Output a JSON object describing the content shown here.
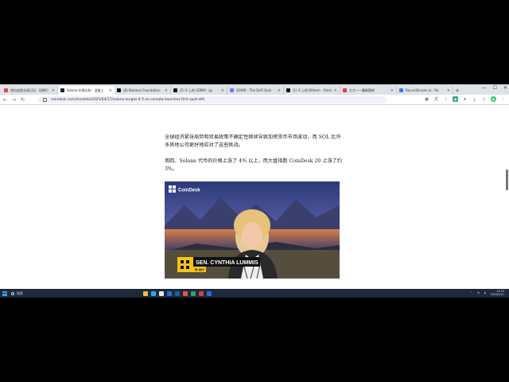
{
  "browser": {
    "tabs": [
      {
        "label": "钱包追踪交易日记：短期行",
        "favicon_color": "#e24a4a"
      },
      {
        "label": "Solana 价格分析：温度上",
        "favicon_color": "#222222",
        "active": true
      },
      {
        "label": "(8) Balance Foundation",
        "favicon_color": "#111111"
      },
      {
        "label": "(1) X 上的 SONIX（@",
        "favicon_color": "#111111"
      },
      {
        "label": "SONIX - The DeFi Quiz",
        "favicon_color": "#6b7cff"
      },
      {
        "label": "(1) X 上的 Bitmon - Omni",
        "favicon_color": "#111111"
      },
      {
        "label": "大力——最新图库",
        "favicon_color": "#e04040"
      },
      {
        "label": "RecordScreen.io - Re",
        "favicon_color": "#2f7df6"
      }
    ],
    "new_tab_label": "+",
    "window_controls": [
      "—",
      "☐",
      "✕"
    ],
    "url": "coindesk.com/markets/2025/04/17/solana-surges-4-5-as-canada-launches-first-spot-etfs"
  },
  "article": {
    "paragraph1": "全球经济紧张局势和贸易政策不确定性继续导致加密货币市场波动，而 SOL 比许多其他公司更好地应对了这些挑战。",
    "paragraph2": "周四，Solana 代币的价格上涨了 4% 以上，而大盘指数 CoinDesk 20 上涨了约 3%。",
    "video": {
      "brand": "CoinDesk",
      "lower_third_name": "SEN. CYNTHIA LUMMIS",
      "lower_third_sub": "R-WY"
    }
  },
  "taskbar": {
    "search_placeholder": "搜索",
    "time": "14:23",
    "date": "2025/4/21",
    "app_colors": [
      "#f0c040",
      "#3aa0f0",
      "#e8e8e8",
      "#1e6fd6",
      "#1b5e9e",
      "#e25a3a",
      "#3c9e5a",
      "#d23f3f",
      "#2a6fd6"
    ]
  }
}
